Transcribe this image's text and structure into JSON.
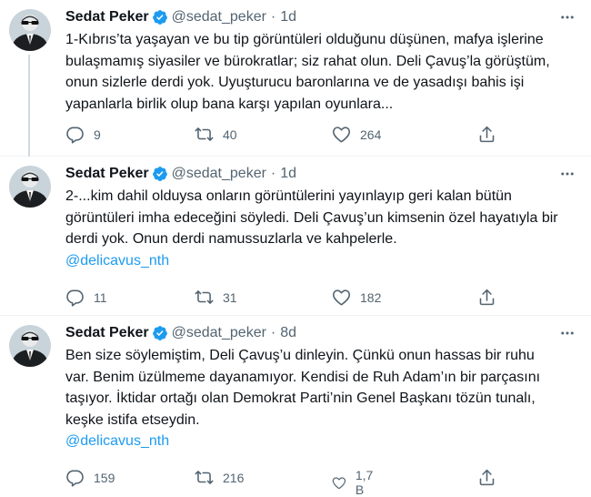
{
  "colors": {
    "link": "#1d9bf0",
    "verified": "#1d9bf0",
    "muted": "#536471",
    "text": "#0f1419"
  },
  "icons": [
    "verified-badge-icon",
    "more-icon",
    "reply-icon",
    "retweet-icon",
    "like-icon",
    "share-icon"
  ],
  "tweets": [
    {
      "name": "Sedat Peker",
      "handle": "@sedat_peker",
      "separator": "·",
      "time": "1d",
      "lines": [
        "1-Kıbrıs’ta yaşayan ve bu tip görüntüleri olduğunu düşünen, mafya işlerine",
        "bulaşmamış siyasiler ve bürokratlar; siz rahat olun. Deli Çavuş’la görüştüm,",
        "onun sizlerle derdi yok. Uyuşturucu baronlarına ve de yasadışı bahis işi",
        "yapanlarla birlik olup bana karşı yapılan oyunlara..."
      ],
      "mention": "",
      "replies": "9",
      "retweets": "40",
      "likes": "264"
    },
    {
      "name": "Sedat Peker",
      "handle": "@sedat_peker",
      "separator": "·",
      "time": "1d",
      "lines": [
        "2-...kim dahil olduysa onların görüntülerini yayınlayıp geri kalan bütün",
        "görüntüleri imha edeceğini söyledi. Deli Çavuş’un kimsenin özel hayatıyla bir",
        "derdi yok. Onun derdi namussuzlarla ve kahpelerle."
      ],
      "mention": "@delicavus_nth",
      "replies": "11",
      "retweets": "31",
      "likes": "182"
    },
    {
      "name": "Sedat Peker",
      "handle": "@sedat_peker",
      "separator": "·",
      "time": "8d",
      "lines": [
        "Ben size söylemiştim, Deli Çavuş’u dinleyin. Çünkü onun hassas bir ruhu",
        "var. Benim üzülmeme dayanamıyor. Kendisi de Ruh Adam’ın bir parçasını",
        "taşıyor. İktidar ortağı olan Demokrat Parti’nin Genel Başkanı tözün tunalı,",
        "keşke istifa etseydin."
      ],
      "mention": "@delicavus_nth",
      "replies": "159",
      "retweets": "216",
      "likes": "1,7 B"
    }
  ]
}
